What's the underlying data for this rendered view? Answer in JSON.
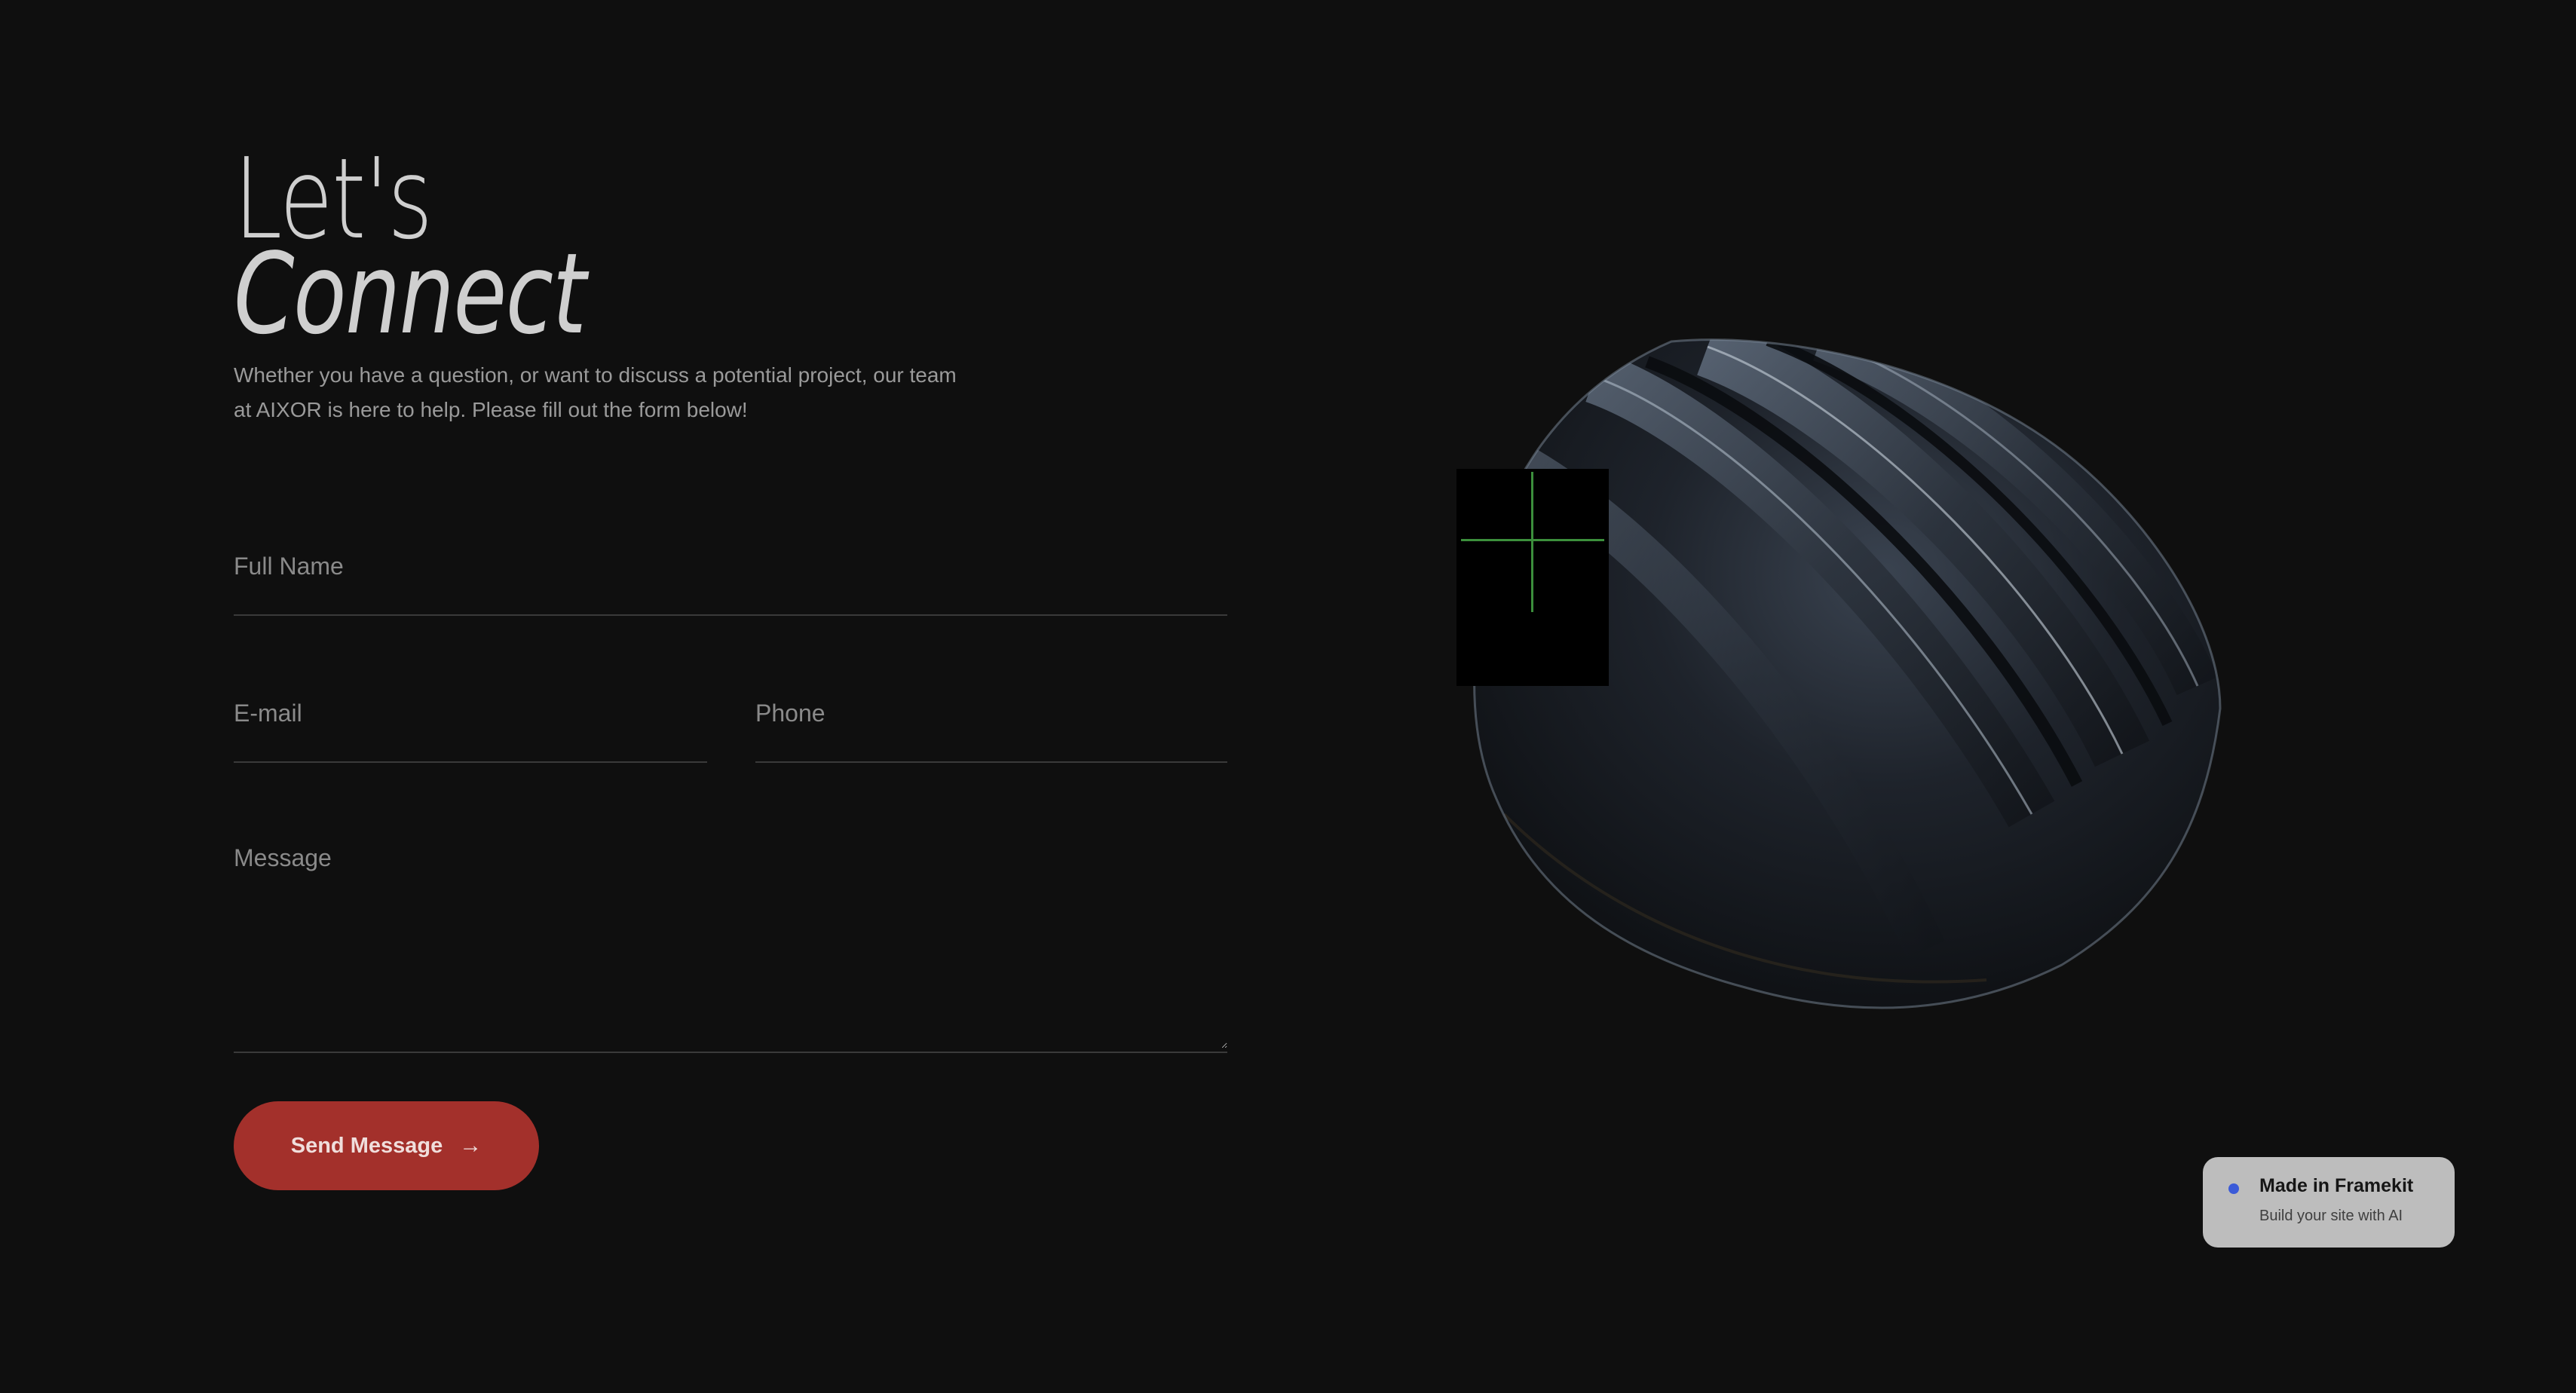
{
  "contact": {
    "headline_line1": "Let's",
    "headline_line2": "Connect",
    "intro": "Whether you have a question, or want to discuss a potential project, our team at AIXOR is here to help. Please fill out the form below!",
    "fields": {
      "full_name": {
        "placeholder": "Full Name",
        "value": ""
      },
      "email": {
        "placeholder": "E-mail",
        "value": ""
      },
      "phone": {
        "placeholder": "Phone",
        "value": ""
      },
      "message": {
        "placeholder": "Message",
        "value": ""
      }
    },
    "send_label": "Send Message",
    "send_icon": "arrow-right-icon"
  },
  "badge": {
    "title": "Made in Framekit",
    "subtitle": "Build your site with AI"
  },
  "colors": {
    "background": "#0f0f0f",
    "accent": "#a3302b",
    "badge_bg": "#bdbdbd",
    "badge_dot": "#3b5bd8",
    "crosshair": "#3c8f3c"
  }
}
